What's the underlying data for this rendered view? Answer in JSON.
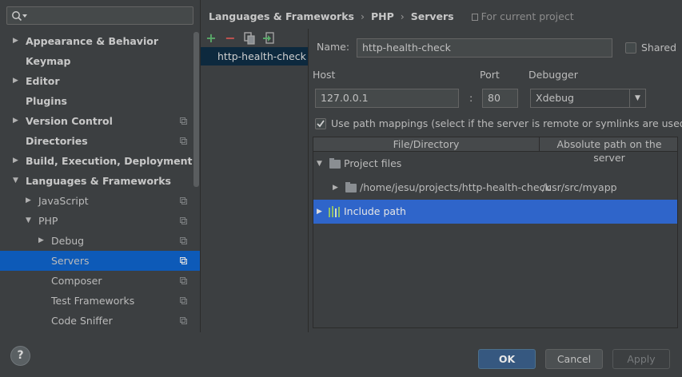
{
  "search": {
    "value": ""
  },
  "tree": [
    {
      "label": "Appearance & Behavior",
      "level": 0,
      "bold": true,
      "arrow": "right",
      "proj": false,
      "selected": false
    },
    {
      "label": "Keymap",
      "level": 0,
      "bold": true,
      "arrow": "",
      "proj": false,
      "selected": false
    },
    {
      "label": "Editor",
      "level": 0,
      "bold": true,
      "arrow": "right",
      "proj": false,
      "selected": false
    },
    {
      "label": "Plugins",
      "level": 0,
      "bold": true,
      "arrow": "",
      "proj": false,
      "selected": false
    },
    {
      "label": "Version Control",
      "level": 0,
      "bold": true,
      "arrow": "right",
      "proj": true,
      "selected": false
    },
    {
      "label": "Directories",
      "level": 0,
      "bold": true,
      "arrow": "",
      "proj": true,
      "selected": false
    },
    {
      "label": "Build, Execution, Deployment",
      "level": 0,
      "bold": true,
      "arrow": "right",
      "proj": false,
      "selected": false
    },
    {
      "label": "Languages & Frameworks",
      "level": 0,
      "bold": true,
      "arrow": "down",
      "proj": false,
      "selected": false
    },
    {
      "label": "JavaScript",
      "level": 1,
      "bold": false,
      "arrow": "right",
      "proj": true,
      "selected": false
    },
    {
      "label": "PHP",
      "level": 1,
      "bold": false,
      "arrow": "down",
      "proj": true,
      "selected": false
    },
    {
      "label": "Debug",
      "level": 2,
      "bold": false,
      "arrow": "right",
      "proj": true,
      "selected": false
    },
    {
      "label": "Servers",
      "level": 2,
      "bold": false,
      "arrow": "",
      "proj": true,
      "selected": true
    },
    {
      "label": "Composer",
      "level": 2,
      "bold": false,
      "arrow": "",
      "proj": true,
      "selected": false
    },
    {
      "label": "Test Frameworks",
      "level": 2,
      "bold": false,
      "arrow": "",
      "proj": true,
      "selected": false
    },
    {
      "label": "Code Sniffer",
      "level": 2,
      "bold": false,
      "arrow": "",
      "proj": true,
      "selected": false
    }
  ],
  "breadcrumb": {
    "items": [
      "Languages & Frameworks",
      "PHP",
      "Servers"
    ],
    "separator": "›",
    "scope": "For current project"
  },
  "servers": {
    "toolbar": {
      "add": "+",
      "remove": "−"
    },
    "items": [
      "http-health-check"
    ]
  },
  "form": {
    "name_label": "Name:",
    "name_value": "http-health-check",
    "shared_label": "Shared",
    "shared_checked": false,
    "host_label": "Host",
    "host_value": "127.0.0.1",
    "colon": ":",
    "port_label": "Port",
    "port_value": "80",
    "debugger_label": "Debugger",
    "debugger_value": "Xdebug",
    "path_mappings_label": "Use path mappings (select if the server is remote or symlinks are used)",
    "path_mappings_checked": true
  },
  "mappings": {
    "headers": [
      "File/Directory",
      "Absolute path on the server"
    ],
    "rows": [
      {
        "icon": "folder-icon",
        "arrow": "down",
        "indent": 0,
        "path": "Project files",
        "server": "",
        "selected": false
      },
      {
        "icon": "folder-icon",
        "arrow": "right",
        "indent": 1,
        "path": "/home/jesu/projects/http-health-check",
        "server": "/usr/src/myapp",
        "selected": false
      },
      {
        "icon": "library-icon",
        "arrow": "right",
        "indent": 0,
        "path": "Include path",
        "server": "",
        "selected": true
      }
    ]
  },
  "buttons": {
    "help": "?",
    "ok": "OK",
    "cancel": "Cancel",
    "apply": "Apply"
  },
  "colors": {
    "background": "#3c3f41",
    "selection": "#0d5ab8",
    "row_selection": "#2f65ca",
    "primary_button": "#365880",
    "add_green": "#59a869",
    "remove_red": "#c75450"
  }
}
